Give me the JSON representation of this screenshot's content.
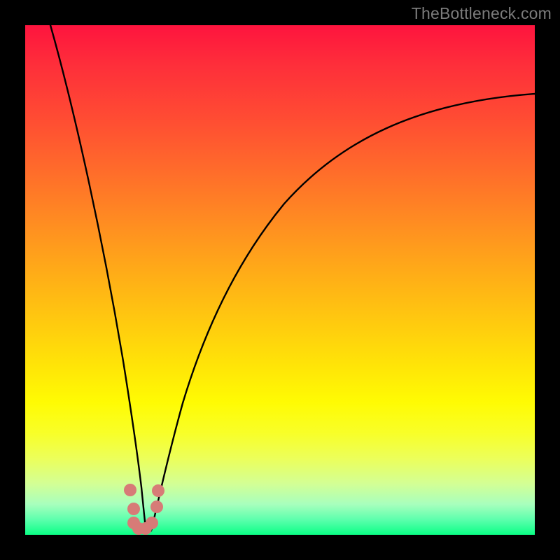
{
  "watermark": "TheBottleneck.com",
  "colors": {
    "frame": "#000000",
    "gradient_top": "#fe143e",
    "gradient_bottom": "#0bff86",
    "curve": "#000000",
    "marker": "#d77b77"
  },
  "chart_data": {
    "type": "line",
    "title": "",
    "xlabel": "",
    "ylabel": "",
    "xlim": [
      0,
      100
    ],
    "ylim": [
      0,
      100
    ],
    "note": "No numeric axes or tick labels are rendered in the image; values below are estimated from pixel positions on a 0–100 normalized grid.",
    "series": [
      {
        "name": "left-branch",
        "x": [
          5,
          8,
          11,
          14,
          16,
          18,
          19.5,
          20.5,
          21.3,
          22,
          22.8
        ],
        "y": [
          100,
          80,
          60,
          42,
          28,
          17,
          10,
          6,
          3.5,
          2,
          1
        ]
      },
      {
        "name": "right-branch",
        "x": [
          22.8,
          24,
          26,
          29,
          33,
          38,
          44,
          52,
          62,
          74,
          88,
          100
        ],
        "y": [
          1,
          3,
          8,
          16,
          26,
          37,
          48,
          58,
          67,
          75,
          81,
          86
        ]
      }
    ],
    "markers": [
      {
        "x": 20.6,
        "y": 8.8
      },
      {
        "x": 21.3,
        "y": 5.1
      },
      {
        "x": 21.3,
        "y": 2.4
      },
      {
        "x": 22.3,
        "y": 1.3
      },
      {
        "x": 23.6,
        "y": 1.3
      },
      {
        "x": 24.8,
        "y": 2.4
      },
      {
        "x": 25.8,
        "y": 5.5
      },
      {
        "x": 26.1,
        "y": 8.6
      }
    ]
  }
}
